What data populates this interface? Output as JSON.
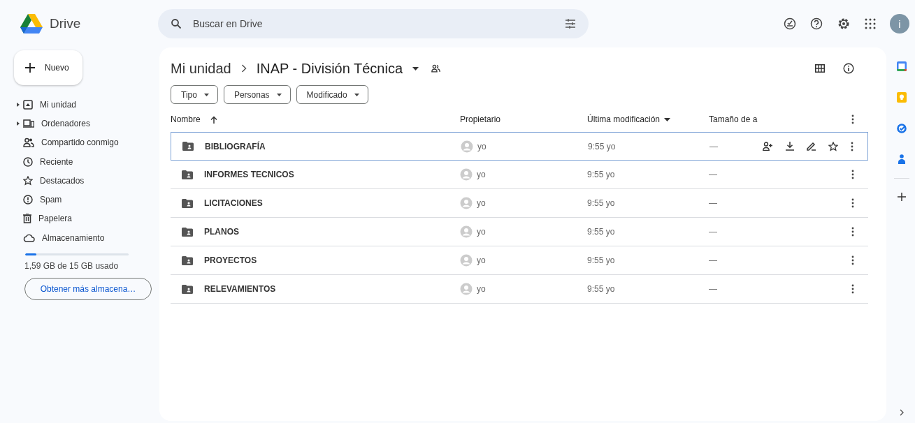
{
  "app": {
    "name": "Drive"
  },
  "search": {
    "placeholder": "Buscar en Drive"
  },
  "new_button": {
    "label": "Nuevo"
  },
  "sidebar": {
    "items": [
      {
        "label": "Mi unidad",
        "kind": "drive",
        "expander": true
      },
      {
        "label": "Ordenadores",
        "kind": "computer",
        "expander": true
      },
      {
        "label": "Compartido conmigo",
        "kind": "people",
        "expander": false
      },
      {
        "label": "Reciente",
        "kind": "clock",
        "expander": false
      },
      {
        "label": "Destacados",
        "kind": "star",
        "expander": false
      },
      {
        "label": "Spam",
        "kind": "spam",
        "expander": false
      },
      {
        "label": "Papelera",
        "kind": "trash",
        "expander": false
      },
      {
        "label": "Almacenamiento",
        "kind": "cloud",
        "expander": false
      }
    ]
  },
  "storage": {
    "level": 0.11,
    "usage": "1,59 GB de 15 GB usado",
    "button": "Obtener más almacena…"
  },
  "breadcrumb": [
    "Mi unidad",
    "INAP - División Técnica"
  ],
  "filters": [
    "Tipo",
    "Personas",
    "Modificado"
  ],
  "table": {
    "columns": [
      "Nombre",
      "Propietario",
      "Última modificación",
      "Tamaño de a"
    ],
    "rows": [
      {
        "name": "BIBLIOGRAFÍA",
        "owner": "yo",
        "modified": "9:55 yo",
        "size": "—",
        "selected": true
      },
      {
        "name": "INFORMES TECNICOS",
        "owner": "yo",
        "modified": "9:55 yo",
        "size": "—",
        "selected": false
      },
      {
        "name": "LICITACIONES",
        "owner": "yo",
        "modified": "9:55 yo",
        "size": "—",
        "selected": false
      },
      {
        "name": "PLANOS",
        "owner": "yo",
        "modified": "9:55 yo",
        "size": "—",
        "selected": false
      },
      {
        "name": "PROYECTOS",
        "owner": "yo",
        "modified": "9:55 yo",
        "size": "—",
        "selected": false
      },
      {
        "name": "RELEVAMIENTOS",
        "owner": "yo",
        "modified": "9:55 yo",
        "size": "—",
        "selected": false
      }
    ]
  },
  "profile": {
    "initial": "i"
  }
}
